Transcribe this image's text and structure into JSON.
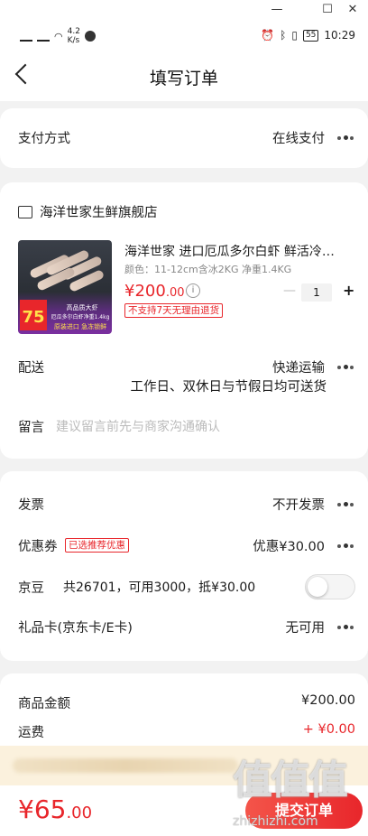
{
  "window": {
    "minimize": "—",
    "maximize": "☐",
    "close": "✕"
  },
  "status": {
    "net": "4.2\nK/s",
    "battery": "55",
    "time": "10:29"
  },
  "nav": {
    "title": "填写订单"
  },
  "payment": {
    "label": "支付方式",
    "value": "在线支付"
  },
  "shop": {
    "name": "海洋世家生鲜旗舰店"
  },
  "product": {
    "title": "海洋世家 进口厄瓜多尔白虾 鲜活冷…",
    "spec": "颜色：11-12cm含冰2KG 净重1.4KG",
    "price_main": "¥200",
    "price_dec": ".00",
    "no_return": "不支持7天无理由退货",
    "qty": "1",
    "minus": "—",
    "plus": "+",
    "thumb_price": "75",
    "thumb_line1": "高品质大虾",
    "thumb_line2": "厄瓜多尔白虾净重1.4kg",
    "thumb_line3": "原装进口 急冻锁鲜"
  },
  "delivery": {
    "label": "配送",
    "value": "快递运输",
    "note": "工作日、双休日与节假日均可送货"
  },
  "message": {
    "label": "留言",
    "placeholder": "建议留言前先与商家沟通确认"
  },
  "invoice": {
    "label": "发票",
    "value": "不开发票"
  },
  "coupon": {
    "label": "优惠券",
    "badge": "已选推荐优惠",
    "value": "优惠¥30.00"
  },
  "jingdou": {
    "label": "京豆",
    "desc": "共26701，可用3000，抵¥30.00"
  },
  "giftcard": {
    "label": "礼品卡(京东卡/E卡)",
    "value": "无可用"
  },
  "summary": {
    "goods_label": "商品金额",
    "goods_value": "¥200.00",
    "shipping_label": "运费",
    "shipping_value": "+ ¥0.00"
  },
  "bottom": {
    "total_main": "¥65",
    "total_dec": ".00",
    "submit": "提交订单"
  },
  "watermark": {
    "big": "值值值",
    "small": "zhizhizhi.com"
  },
  "colors": {
    "accent": "#e8262b",
    "background": "#f2f2f2"
  }
}
